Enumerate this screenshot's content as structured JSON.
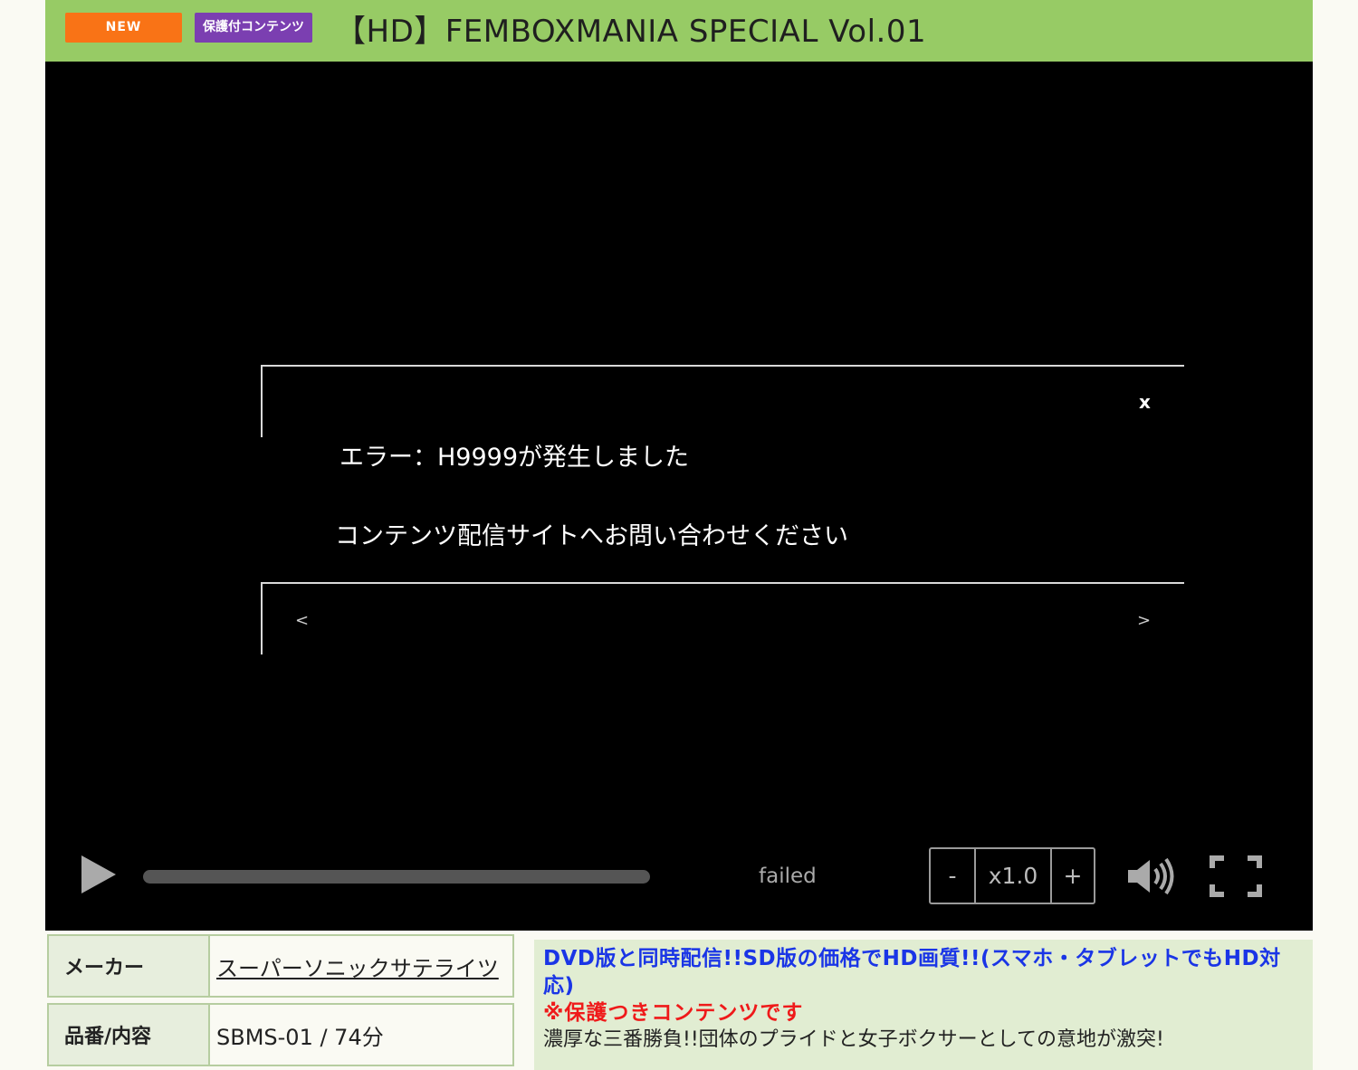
{
  "header": {
    "badge_new": "NEW",
    "badge_protected": "保護付コンテンツ",
    "title": "【HD】FEMBOXMANIA SPECIAL Vol.01"
  },
  "player": {
    "error_close": "x",
    "error_line1": "エラー：H9999が発生しました",
    "error_line2": "コンテンツ配信サイトへお問い合わせください",
    "nav_prev": "<",
    "nav_next": ">",
    "status": "failed",
    "speed_minus": "-",
    "speed_value": "x1.0",
    "speed_plus": "+",
    "progress": 0
  },
  "info": {
    "maker_label": "メーカー",
    "maker_value": "スーパーソニックサテライツ",
    "code_label": "品番/内容",
    "code_value": "SBMS-01 / 74分"
  },
  "description": {
    "line1": "DVD版と同時配信!!SD版の価格でHD画質!!(スマホ・タブレットでもHD対応)",
    "line2": "※保護つきコンテンツです",
    "line3": "濃厚な三番勝負!!団体のプライドと女子ボクサーとしての意地が激突!"
  },
  "colors": {
    "header_bg": "#97cb65",
    "badge_new": "#f97316",
    "badge_protected": "#7b3fb1",
    "desc_blue": "#1a35e6",
    "desc_red": "#ef1a1a"
  }
}
